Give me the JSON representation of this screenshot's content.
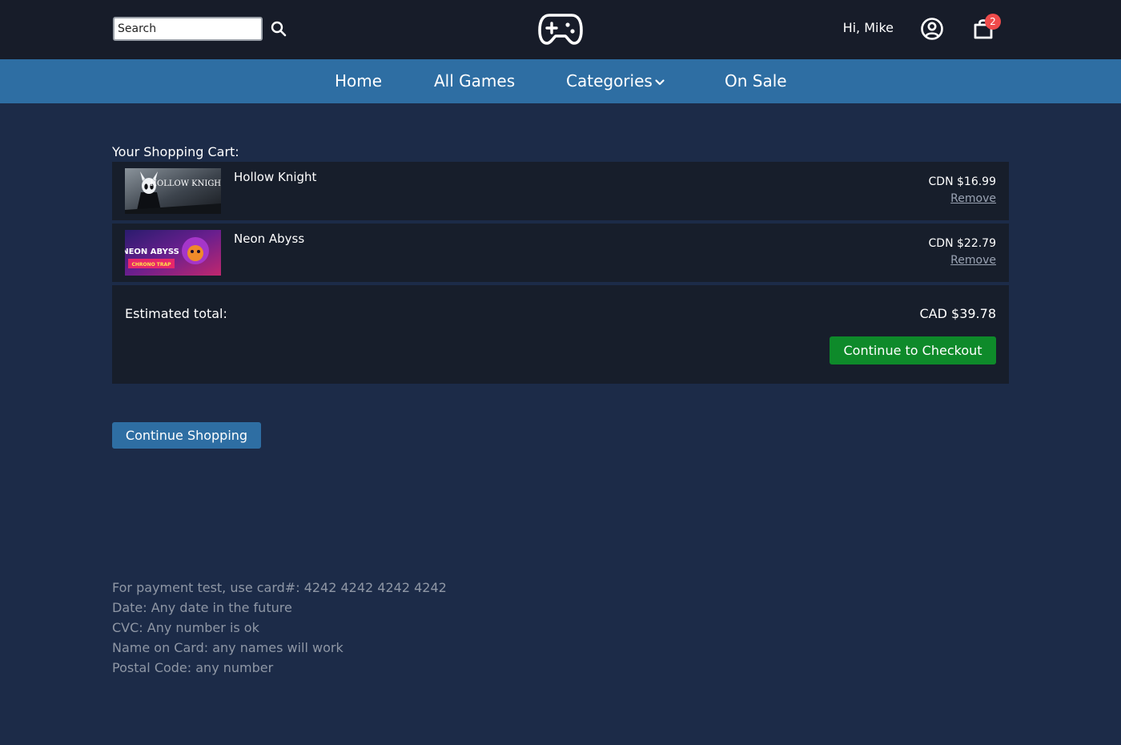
{
  "header": {
    "search_placeholder": "Search",
    "greeting": "Hi, Mike",
    "cart_count": "2",
    "icons": [
      "search-icon",
      "gamepad-logo-icon",
      "account-icon",
      "shopping-bag-icon"
    ]
  },
  "nav": {
    "items": [
      {
        "label": "Home"
      },
      {
        "label": "All Games"
      },
      {
        "label": "Categories"
      },
      {
        "label": "On Sale"
      }
    ]
  },
  "cart": {
    "title": "Your Shopping Cart:",
    "items": [
      {
        "name": "Hollow Knight",
        "thumb_text": "HOLLOW KNIGHT",
        "price": "CDN $16.99",
        "remove_label": "Remove"
      },
      {
        "name": "Neon Abyss",
        "thumb_text": "NEON ABYSS",
        "thumb_subtext": "CHRONO TRAP",
        "price": "CDN $22.79",
        "remove_label": "Remove"
      }
    ],
    "summary": {
      "label": "Estimated total:",
      "value": "CAD $39.78",
      "checkout_label": "Continue to Checkout"
    },
    "continue_shopping_label": "Continue Shopping"
  },
  "notes": [
    "For payment test, use card#: 4242 4242 4242 4242",
    "Date: Any date in the future",
    "CVC: Any number is ok",
    "Name on Card: any names will work",
    "Postal Code: any number"
  ],
  "colors": {
    "page_bg": "#1c2b48",
    "header_bg": "#171c29",
    "nav_bg": "#2e6ea3",
    "card_bg": "#171e2b",
    "checkout_green": "#0e8a2a",
    "badge_red": "#ef4b4b",
    "muted_text": "#8f97a5"
  }
}
